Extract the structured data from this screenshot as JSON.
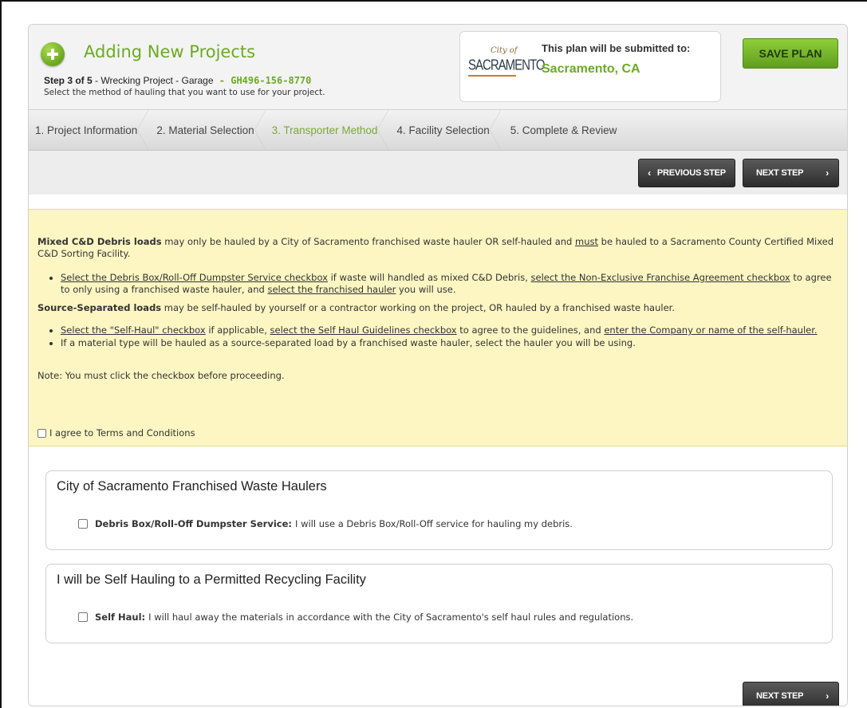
{
  "header": {
    "title": "Adding New Projects",
    "step_label": "Step 3 of 5",
    "step_separator": " - ",
    "project_label": "Wrecking Project - Garage",
    "id_separator": " - ",
    "project_id": "GH496-156-8770",
    "description": "Select the method of hauling that you want to use for your project."
  },
  "submit_box": {
    "logo_city": "City of",
    "logo_name": "SACRAMENTO",
    "label": "This plan will be submitted to:",
    "city": "Sacramento, CA"
  },
  "save_button": "SAVE PLAN",
  "steps": [
    "1. Project Information",
    "2. Material Selection",
    "3. Transporter Method",
    "4. Facility Selection",
    "5. Complete & Review"
  ],
  "nav": {
    "previous": "PREVIOUS STEP",
    "next": "NEXT STEP"
  },
  "notice": {
    "mixed_title": "Mixed C&D Debris loads",
    "mixed_text_1": " may only be hauled by a City of Sacramento franchised waste hauler OR self-hauled and ",
    "mixed_must": "must",
    "mixed_text_2": " be hauled to a Sacramento County Certified Mixed C&D Sorting Facility.",
    "mixed_bullet_link1": "Select the Debris Box/Roll-Off Dumpster Service checkbox",
    "mixed_bullet_text1": " if waste will handled as mixed C&D Debris, ",
    "mixed_bullet_link2": "select the Non-Exclusive Franchise Agreement checkbox",
    "mixed_bullet_text2": " to agree to only using a franchised waste hauler, and ",
    "mixed_bullet_link3": "select the franchised hauler",
    "mixed_bullet_text3": " you will use.",
    "source_title": "Source-Separated loads",
    "source_text": " may be self-hauled by yourself or a contractor working on the project, OR hauled by a franchised waste hauler.",
    "source_b1_link1": "Select the \"Self-Haul\" checkbox",
    "source_b1_text1": " if applicable, ",
    "source_b1_link2": "select the Self Haul Guidelines checkbox",
    "source_b1_text2": " to agree to the guidelines, and ",
    "source_b1_link3": "enter the Company or name of the self-hauler.",
    "source_b2": "If a material type will be hauled as a source-separated load by a franchised waste hauler, select the hauler you will be using.",
    "note": "Note: You must click the checkbox before proceeding.",
    "agree_label": "I agree to Terms and Conditions"
  },
  "panels": [
    {
      "title": "City of Sacramento Franchised Waste Haulers",
      "option_bold": "Debris Box/Roll-Off Dumpster Service:",
      "option_text": "I will use a Debris Box/Roll-Off service for hauling my debris."
    },
    {
      "title": "I will be Self Hauling to a Permitted Recycling Facility",
      "option_bold": "Self Haul:",
      "option_text": "I will haul away the materials in accordance with the City of Sacramento's self haul rules and regulations."
    }
  ],
  "colors": {
    "brand_green": "#6bab22",
    "notice_bg": "#fdf6c3",
    "dark_button": "#2c2c2c"
  }
}
